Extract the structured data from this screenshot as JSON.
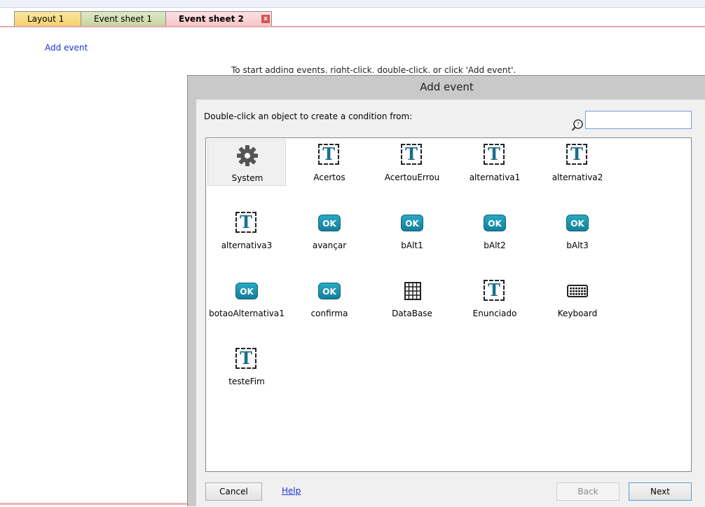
{
  "tabs": [
    {
      "label": "Layout 1"
    },
    {
      "label": "Event sheet 1"
    },
    {
      "label": "Event sheet 2"
    }
  ],
  "tab_close_glyph": "x",
  "sheet": {
    "add_event_link": "Add event",
    "hint": "To start adding events, right-click, double-click, or click 'Add event'."
  },
  "dialog": {
    "title": "Add event",
    "instruction": "Double-click an object to create a condition from:",
    "search": {
      "value": "",
      "placeholder": "",
      "icon": "search-help-icon"
    },
    "objects": [
      {
        "label": "System",
        "icon": "gear-icon",
        "selected": true
      },
      {
        "label": "Acertos",
        "icon": "text-object-icon"
      },
      {
        "label": "AcertouErrou",
        "icon": "text-object-icon"
      },
      {
        "label": "alternativa1",
        "icon": "text-object-icon"
      },
      {
        "label": "alternativa2",
        "icon": "text-object-icon"
      },
      {
        "label": "alternativa3",
        "icon": "text-object-icon"
      },
      {
        "label": "avançar",
        "icon": "button-object-icon"
      },
      {
        "label": "bAlt1",
        "icon": "button-object-icon"
      },
      {
        "label": "bAlt2",
        "icon": "button-object-icon"
      },
      {
        "label": "bAlt3",
        "icon": "button-object-icon"
      },
      {
        "label": "botaoAlternativa1",
        "icon": "button-object-icon"
      },
      {
        "label": "confirma",
        "icon": "button-object-icon"
      },
      {
        "label": "DataBase",
        "icon": "grid-icon"
      },
      {
        "label": "Enunciado",
        "icon": "text-object-icon"
      },
      {
        "label": "Keyboard",
        "icon": "keyboard-icon"
      },
      {
        "label": "testeFim",
        "icon": "text-object-icon"
      }
    ],
    "icon_glyphs": {
      "text": "T",
      "button": "OK"
    },
    "buttons": {
      "cancel": "Cancel",
      "help": "Help",
      "back": "Back",
      "next": "Next"
    }
  },
  "colors": {
    "link": "#1a32d6",
    "button_icon": "#1a8aa6",
    "tab_active": "#f6c2c5"
  }
}
